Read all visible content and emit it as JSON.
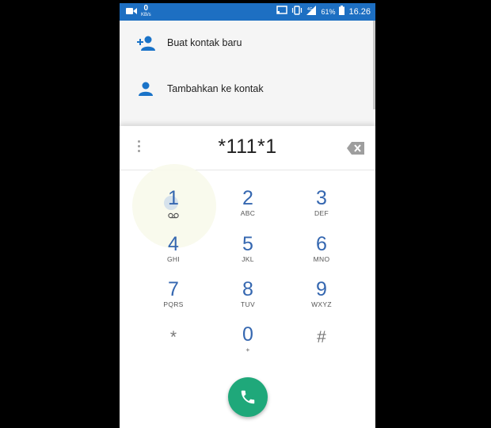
{
  "status_bar": {
    "net_speed": "0",
    "net_unit": "KB/s",
    "battery_percent": "61%",
    "time": "16.26",
    "icons": [
      "video-camera-icon",
      "cast-icon",
      "vibrate-icon",
      "signal-icon",
      "battery-icon"
    ]
  },
  "suggestions": [
    {
      "label": "Buat kontak baru",
      "icon": "add-person-icon"
    },
    {
      "label": "Tambahkan ke kontak",
      "icon": "person-icon"
    }
  ],
  "dialer": {
    "digits": "*111*1",
    "keys": [
      {
        "digit": "1",
        "letters": ""
      },
      {
        "digit": "2",
        "letters": "ABC"
      },
      {
        "digit": "3",
        "letters": "DEF"
      },
      {
        "digit": "4",
        "letters": "GHI"
      },
      {
        "digit": "5",
        "letters": "JKL"
      },
      {
        "digit": "6",
        "letters": "MNO"
      },
      {
        "digit": "7",
        "letters": "PQRS"
      },
      {
        "digit": "8",
        "letters": "TUV"
      },
      {
        "digit": "9",
        "letters": "WXYZ"
      },
      {
        "digit": "*",
        "letters": ""
      },
      {
        "digit": "0",
        "letters": "+"
      },
      {
        "digit": "#",
        "letters": ""
      }
    ]
  },
  "colors": {
    "status_bar": "#1d6fc2",
    "icon_blue": "#1a73c8",
    "digit_blue": "#3567b0",
    "call_green": "#1fa87a"
  }
}
